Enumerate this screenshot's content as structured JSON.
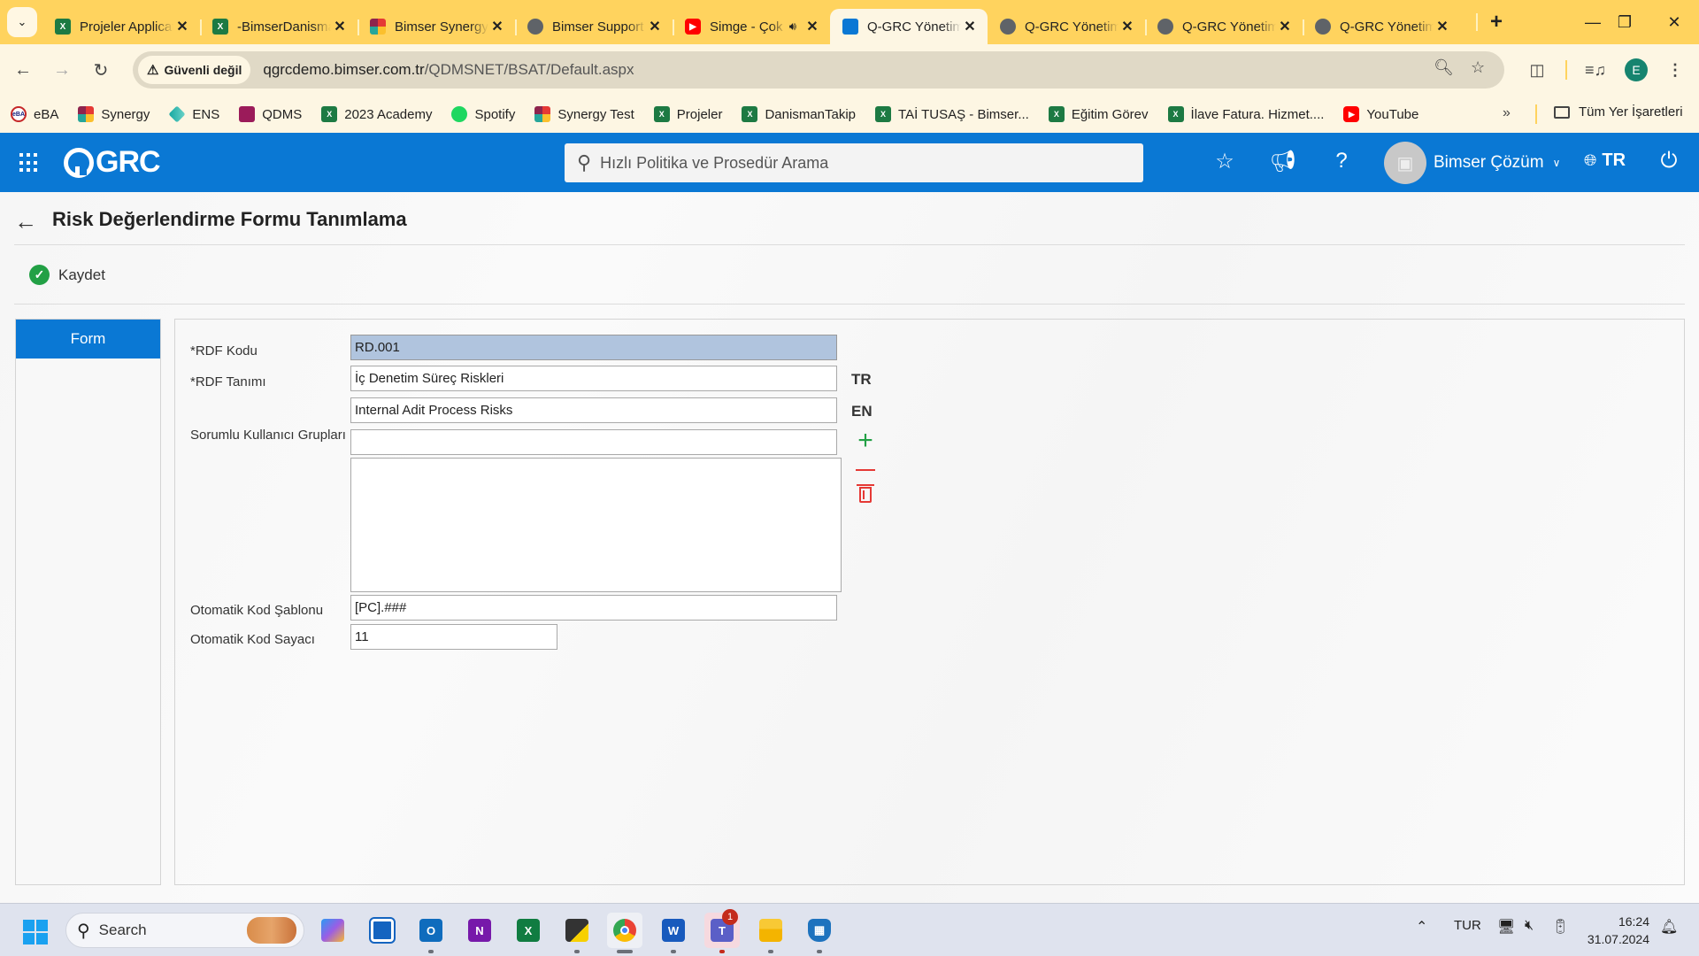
{
  "browser": {
    "tabs": [
      {
        "title": "Projeler Applications",
        "icon": "excel-icon",
        "active": false
      },
      {
        "title": "-BimserDanismanlik",
        "icon": "excel-icon",
        "active": false
      },
      {
        "title": "Bimser Synergy",
        "icon": "synergy-icon",
        "active": false
      },
      {
        "title": "Bimser Support",
        "icon": "globe-icon",
        "active": false
      },
      {
        "title": "Simge - Çok",
        "icon": "youtube-icon",
        "active": false,
        "audio": true
      },
      {
        "title": "Q-GRC Yönetim",
        "icon": "qgrc-icon",
        "active": true
      },
      {
        "title": "Q-GRC Yönetim",
        "icon": "globe-icon",
        "active": false
      },
      {
        "title": "Q-GRC Yönetim",
        "icon": "globe-icon",
        "active": false
      },
      {
        "title": "Q-GRC Yönetim",
        "icon": "globe-icon",
        "active": false
      }
    ],
    "security_label": "Güvenli değil",
    "url_host": "qgrcdemo.bimser.com.tr",
    "url_path": "/QDMSNET/BSAT/Default.aspx",
    "profile_initial": "E",
    "bookmarks": [
      {
        "label": "eBA",
        "icon": "eba"
      },
      {
        "label": "Synergy",
        "icon": "syn"
      },
      {
        "label": "ENS",
        "icon": "ens"
      },
      {
        "label": "QDMS",
        "icon": "qdms"
      },
      {
        "label": "2023 Academy",
        "icon": "excel"
      },
      {
        "label": "Spotify",
        "icon": "spot"
      },
      {
        "label": "Synergy Test",
        "icon": "syn"
      },
      {
        "label": "Projeler",
        "icon": "excel"
      },
      {
        "label": "DanismanTakip",
        "icon": "excel"
      },
      {
        "label": "TAİ TUSAŞ - Bimser...",
        "icon": "excel"
      },
      {
        "label": "Eğitim Görev",
        "icon": "excel"
      },
      {
        "label": "İlave Fatura. Hizmet....",
        "icon": "excel"
      },
      {
        "label": "YouTube",
        "icon": "yt"
      }
    ],
    "all_bookmarks_label": "Tüm Yer İşaretleri"
  },
  "app": {
    "logo": "GRC",
    "search_placeholder": "Hızlı Politika ve Prosedür Arama",
    "user_name": "Bimser Çözüm",
    "language": "TR",
    "accent_color": "#0a78d4"
  },
  "page": {
    "title": "Risk Değerlendirme Formu Tanımlama",
    "save_label": "Kaydet",
    "side_tab": "Form",
    "form": {
      "rdf_code_label": "*RDF Kodu",
      "rdf_code_value": "RD.001",
      "rdf_name_label": "*RDF Tanımı",
      "rdf_name_tr_value": "İç Denetim Süreç Riskleri",
      "rdf_name_tr_lang": "TR",
      "rdf_name_en_value": "Internal Adit Process Risks",
      "rdf_name_en_lang": "EN",
      "responsible_groups_label": "Sorumlu Kullanıcı Grupları",
      "responsible_groups_value": "",
      "responsible_groups_list": [],
      "auto_code_template_label": "Otomatik Kod Şablonu",
      "auto_code_template_value": "[PC].###",
      "auto_code_counter_label": "Otomatik Kod Sayacı",
      "auto_code_counter_value": "11"
    }
  },
  "taskbar": {
    "search_label": "Search",
    "language": "TUR",
    "time": "16:24",
    "date": "31.07.2024",
    "teams_badge": "1"
  }
}
